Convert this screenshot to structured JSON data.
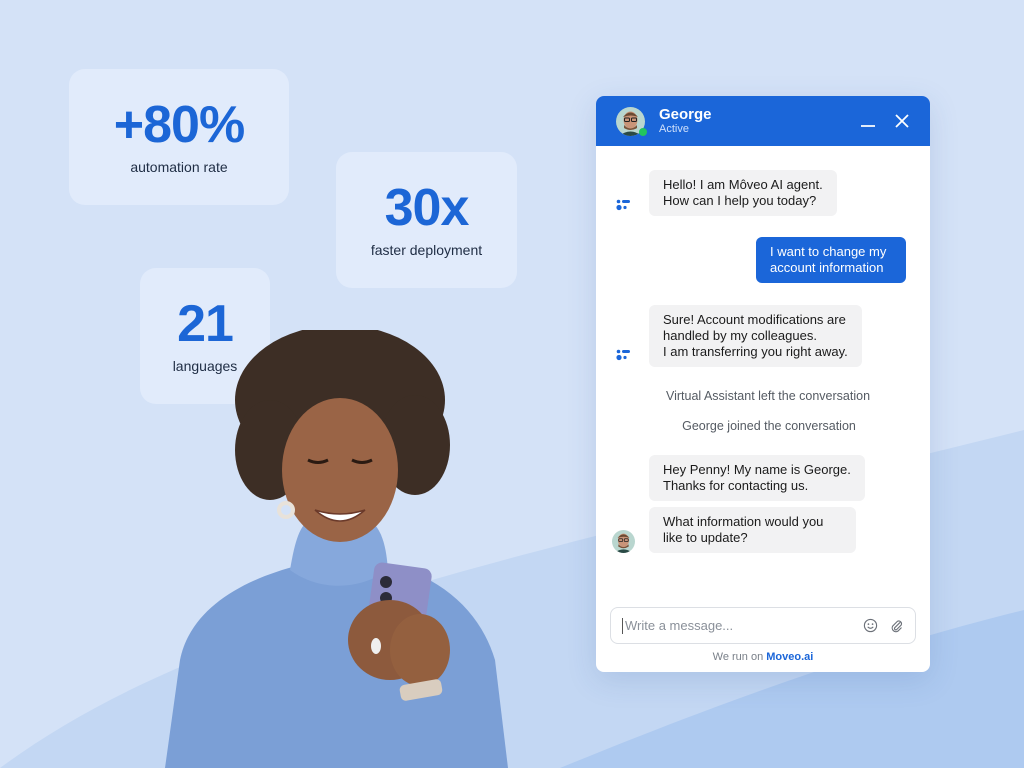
{
  "stats": [
    {
      "value": "+80%",
      "label": "automation rate"
    },
    {
      "value": "30x",
      "label": "faster deployment"
    },
    {
      "value": "21",
      "label": "languages"
    }
  ],
  "chat": {
    "agent_name": "George",
    "agent_status": "Active",
    "header_icons": {
      "minimize": "minimize-icon",
      "close": "close-icon"
    },
    "messages": [
      {
        "from": "bot",
        "text": "Hello! I am Môveo AI agent.\nHow can I help you today?"
      },
      {
        "from": "user",
        "text": "I want to change my\naccount information"
      },
      {
        "from": "bot",
        "text": "Sure! Account modifications are\nhandled by my colleagues.\nI am transferring you right away."
      },
      {
        "from": "system",
        "text": "Virtual Assistant left the conversation"
      },
      {
        "from": "system",
        "text": "George joined the conversation"
      },
      {
        "from": "agent",
        "text": "Hey Penny! My name is George.\nThanks for contacting us."
      },
      {
        "from": "agent",
        "text": "What information would you\nlike to update?"
      }
    ],
    "composer": {
      "placeholder": "Write a message...",
      "value": "",
      "icons": {
        "emoji": "emoji-icon",
        "attach": "paperclip-icon"
      }
    },
    "footer": {
      "prefix": "We run on",
      "link": "Moveo.ai"
    }
  },
  "colors": {
    "background": "#d4e2f7",
    "card": "#e1ebfb",
    "accent": "#1b66d9",
    "online": "#22c55e"
  }
}
